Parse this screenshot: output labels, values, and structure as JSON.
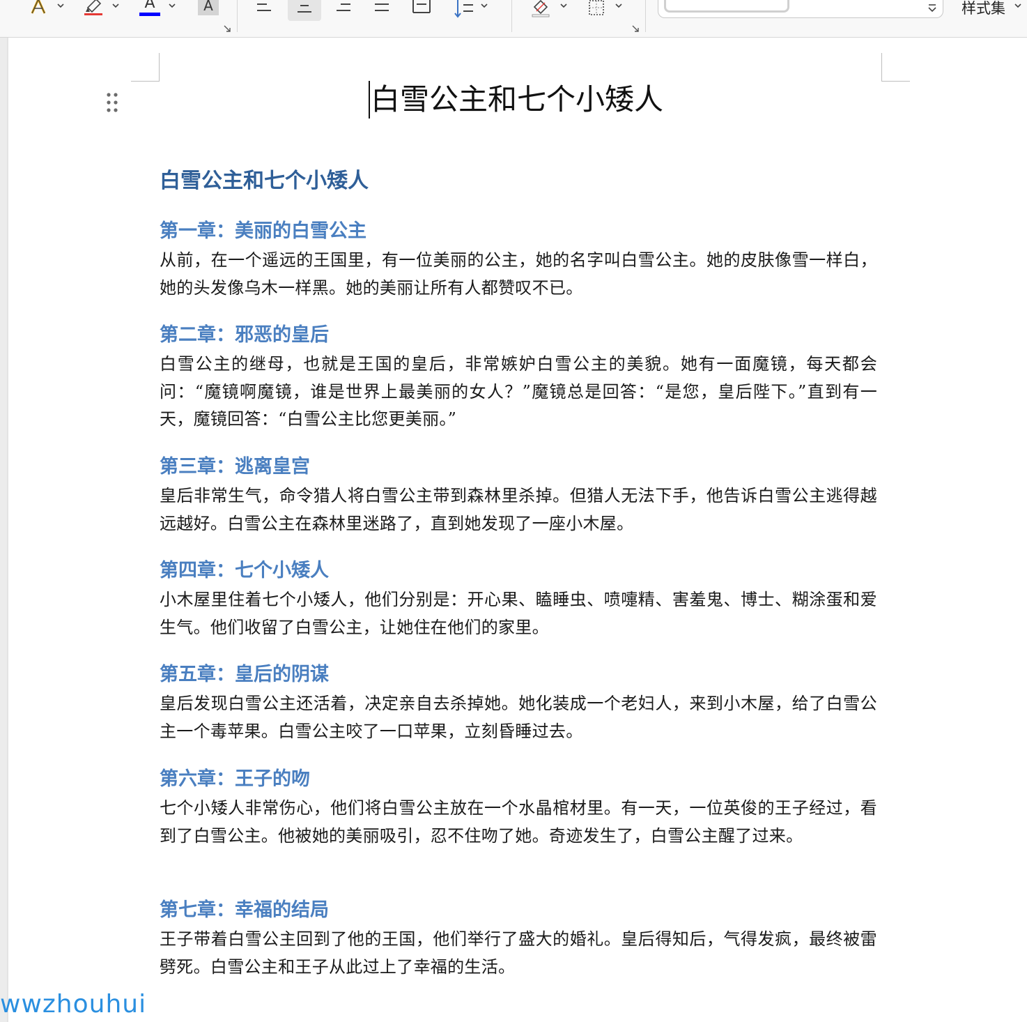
{
  "toolbar": {
    "style_set_label": "样式集",
    "text_effect_glyph": "A",
    "font_color_glyph": "A",
    "char_shading_glyph": "A",
    "font_color_value": "#0000ff",
    "highlight_color_value": "#e53935"
  },
  "document": {
    "title": "白雪公主和七个小矮人",
    "heading": "白雪公主和七个小矮人",
    "chapters": [
      {
        "heading": "第一章：美丽的白雪公主",
        "body": "从前，在一个遥远的王国里，有一位美丽的公主，她的名字叫白雪公主。她的皮肤像雪一样白，她的头发像乌木一样黑。她的美丽让所有人都赞叹不已。"
      },
      {
        "heading": "第二章：邪恶的皇后",
        "body": "白雪公主的继母，也就是王国的皇后，非常嫉妒白雪公主的美貌。她有一面魔镜，每天都会问：“魔镜啊魔镜，谁是世界上最美丽的女人？”魔镜总是回答：“是您，皇后陛下。”直到有一天，魔镜回答：“白雪公主比您更美丽。”"
      },
      {
        "heading": "第三章：逃离皇宫",
        "body": "皇后非常生气，命令猎人将白雪公主带到森林里杀掉。但猎人无法下手，他告诉白雪公主逃得越远越好。白雪公主在森林里迷路了，直到她发现了一座小木屋。"
      },
      {
        "heading": "第四章：七个小矮人",
        "body": "小木屋里住着七个小矮人，他们分别是：开心果、瞌睡虫、喷嚏精、害羞鬼、博士、糊涂蛋和爱生气。他们收留了白雪公主，让她住在他们的家里。"
      },
      {
        "heading": "第五章：皇后的阴谋",
        "body": "皇后发现白雪公主还活着，决定亲自去杀掉她。她化装成一个老妇人，来到小木屋，给了白雪公主一个毒苹果。白雪公主咬了一口苹果，立刻昏睡过去。"
      },
      {
        "heading": "第六章：王子的吻",
        "body": "七个小矮人非常伤心，他们将白雪公主放在一个水晶棺材里。有一天，一位英俊的王子经过，看到了白雪公主。他被她的美丽吸引，忍不住吻了她。奇迹发生了，白雪公主醒了过来。"
      },
      {
        "heading": "第七章：幸福的结局",
        "body": "王子带着白雪公主回到了他的王国，他们举行了盛大的婚礼。皇后得知后，气得发疯，最终被雷劈死。白雪公主和王子从此过上了幸福的生活。"
      }
    ]
  },
  "watermark": "wwzhouhui"
}
